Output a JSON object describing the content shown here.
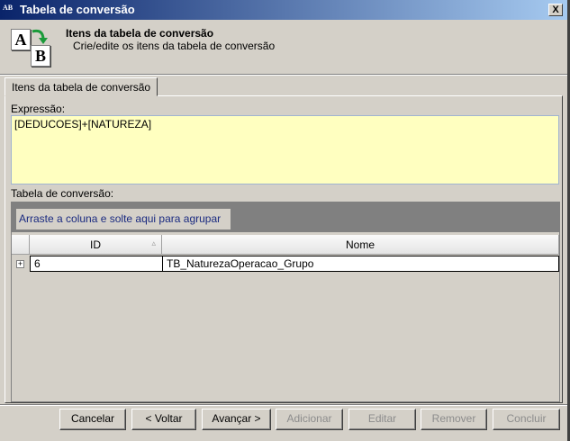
{
  "window": {
    "title": "Tabela de conversão",
    "close_label": "X"
  },
  "header": {
    "title": "Itens da tabela de conversão",
    "subtitle": "Crie/edite os itens da tabela de conversão",
    "icon_a": "A",
    "icon_b": "B"
  },
  "tabs": [
    {
      "label": "Itens da tabela de conversão",
      "active": true
    }
  ],
  "expression": {
    "label": "Expressão:",
    "value": "[DEDUCOES]+[NATUREZA]"
  },
  "table": {
    "label": "Tabela de conversão:",
    "group_hint": "Arraste a coluna e solte aqui para agrupar",
    "columns": [
      "ID",
      "Nome"
    ],
    "sort_indicator": "▵",
    "rows": [
      {
        "id": "6",
        "nome": "TB_NaturezaOperacao_Grupo"
      }
    ]
  },
  "buttons": {
    "cancel": "Cancelar",
    "back": "< Voltar",
    "next": "Avançar >",
    "add": "Adicionar",
    "edit": "Editar",
    "remove": "Remover",
    "finish": "Concluir"
  }
}
